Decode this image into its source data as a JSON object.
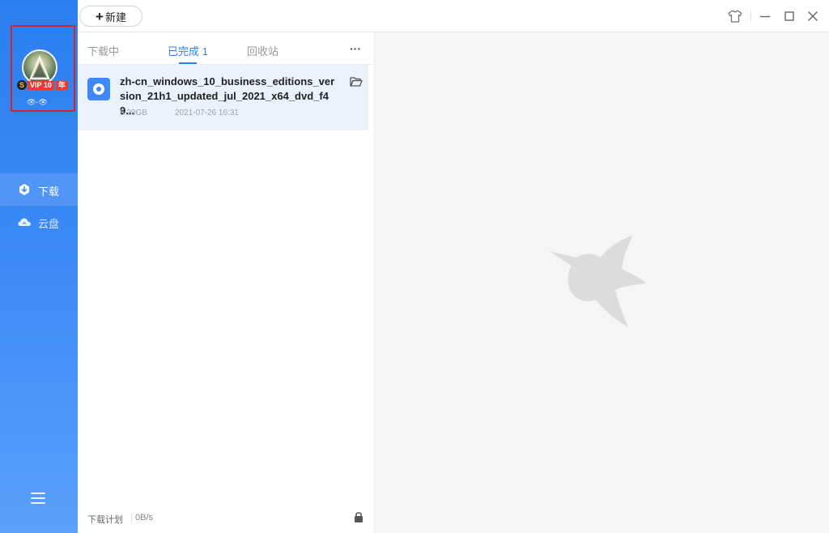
{
  "sidebar": {
    "vip_label": "VIP 10",
    "vip_suffix": "年",
    "nickname": "👁-👁",
    "items": [
      {
        "label": "下载",
        "icon": "download-icon",
        "active": true
      },
      {
        "label": "云盘",
        "icon": "cloud-icon",
        "active": false
      }
    ],
    "menu_icon": "hamburger-menu-icon"
  },
  "toolbar": {
    "new_label": "新建",
    "window_controls": [
      "skin-icon",
      "minimize-icon",
      "maximize-icon",
      "close-icon"
    ]
  },
  "tabs": [
    {
      "label": "下载中",
      "active": false
    },
    {
      "label": "已完成 1",
      "active": true
    },
    {
      "label": "回收站",
      "active": false
    }
  ],
  "more_label": "···",
  "downloads": [
    {
      "name": "zh-cn_windows_10_business_editions_version_21h1_updated_jul_2021_x64_dvd_f49...",
      "size": "5.29GB",
      "date": "2021-07-26 16:31"
    }
  ],
  "status": {
    "plan": "下载计划",
    "speed": "0B/s"
  },
  "colors": {
    "accent": "#2b7ff0",
    "selected_row": "#eaf2fe",
    "vip_red": "#e93c2f"
  }
}
